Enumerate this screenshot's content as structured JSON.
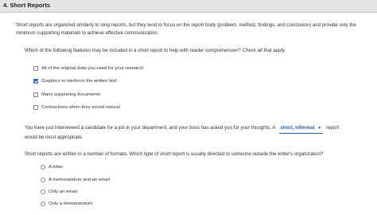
{
  "header": {
    "title": "4. Short Reports"
  },
  "intro": "Short reports are organized similarly to long reports, but they tend to focus on the report body (problem, method, findings, and conclusion) and provide only the minimum supporting materials to achieve effective communication.",
  "question1": {
    "text": "Which of the following features may be included in a short report to help with reader comprehension?",
    "hint": "Check all that apply.",
    "options": [
      {
        "label": "All of the original data you used for your research",
        "checked": false
      },
      {
        "label": "Graphics to reinforce the written text",
        "checked": true
      },
      {
        "label": "Many supporting documents",
        "checked": false
      },
      {
        "label": "Contractions when they sound natural",
        "checked": false
      }
    ]
  },
  "fill": {
    "before": "You have just interviewed a candidate for a job in your department, and your boss has asked you for your thoughts. A",
    "dropdown_value": "short, informal",
    "after": "report would be most appropriate."
  },
  "question2": {
    "text": "Short reports are written in a number of formats. Which type of short report is usually directed to someone outside the writer's organization?",
    "options": [
      {
        "label": "A letter"
      },
      {
        "label": "A memorandum and an email"
      },
      {
        "label": "Only an email"
      },
      {
        "label": "Only a memorandum"
      }
    ]
  }
}
